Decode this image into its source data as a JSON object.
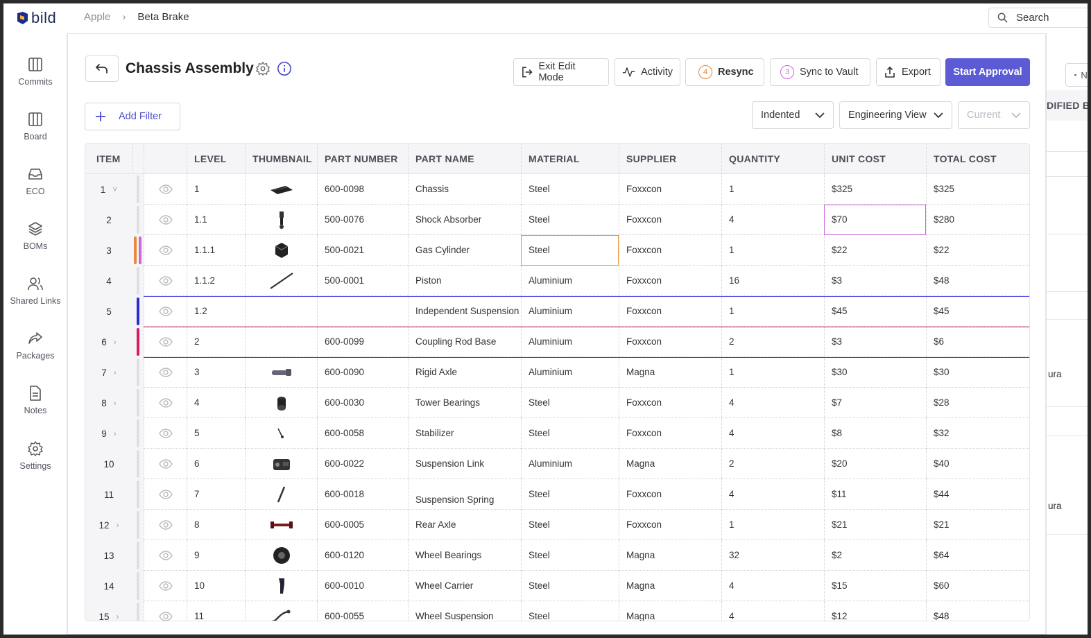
{
  "app": {
    "logo_text": "bild",
    "brand_color": "#5b5bd6",
    "breadcrumb": [
      "Apple",
      "Beta Brake"
    ],
    "search_label": "Search"
  },
  "sidebar": {
    "items": [
      {
        "label": "Commits",
        "icon": "columns-icon"
      },
      {
        "label": "Board",
        "icon": "board-icon"
      },
      {
        "label": "ECO",
        "icon": "inbox-icon"
      },
      {
        "label": "BOMs",
        "icon": "layers-icon"
      },
      {
        "label": "Shared Links",
        "icon": "users-icon"
      },
      {
        "label": "Packages",
        "icon": "share-icon"
      },
      {
        "label": "Notes",
        "icon": "note-icon"
      },
      {
        "label": "Settings",
        "icon": "gear-icon"
      }
    ]
  },
  "header": {
    "title": "Chassis Assembly",
    "buttons": {
      "exit_edit": "Exit Edit Mode",
      "activity": "Activity",
      "resync": "Resync",
      "resync_count": "4",
      "sync_vault": "Sync to Vault",
      "sync_vault_count": "3",
      "export": "Export",
      "start_approval": "Start Approval"
    }
  },
  "toolbar": {
    "add_filter": "Add Filter",
    "view_mode": "Indented",
    "view_type": "Engineering View",
    "version": "Current"
  },
  "table": {
    "columns": [
      "ITEM",
      "LEVEL",
      "THUMBNAIL",
      "PART NUMBER",
      "PART NAME",
      "MATERIAL",
      "SUPPLIER",
      "QUANTITY",
      "UNIT COST",
      "TOTAL COST"
    ],
    "rows": [
      {
        "item": "1",
        "level": "1",
        "part_number": "600-0098",
        "part_name": "Chassis",
        "material": "Steel",
        "supplier": "Foxxcon",
        "quantity": "1",
        "unit_cost": "$325",
        "total_cost": "$325"
      },
      {
        "item": "2",
        "level": "1.1",
        "part_number": "500-0076",
        "part_name": "Shock Absorber",
        "material": "Steel",
        "supplier": "Foxxcon",
        "quantity": "4",
        "unit_cost": "$70",
        "total_cost": "$280"
      },
      {
        "item": "3",
        "level": "1.1.1",
        "part_number": "500-0021",
        "part_name": "Gas Cylinder",
        "material": "Steel",
        "supplier": "Foxxcon",
        "quantity": "1",
        "unit_cost": "$22",
        "total_cost": "$22"
      },
      {
        "item": "4",
        "level": "1.1.2",
        "part_number": "500-0001",
        "part_name": "Piston",
        "material": "Aluminium",
        "supplier": "Foxxcon",
        "quantity": "16",
        "unit_cost": "$3",
        "total_cost": "$48"
      },
      {
        "item": "5",
        "level": "1.2",
        "part_number": "",
        "part_name": "Independent Suspension",
        "material": "Aluminium",
        "supplier": "Foxxcon",
        "quantity": "1",
        "unit_cost": "$45",
        "total_cost": "$45"
      },
      {
        "item": "6",
        "level": "2",
        "part_number": "600-0099",
        "part_name": "Coupling Rod Base",
        "material": "Aluminium",
        "supplier": "Foxxcon",
        "quantity": "2",
        "unit_cost": "$3",
        "total_cost": "$6"
      },
      {
        "item": "7",
        "level": "3",
        "part_number": "600-0090",
        "part_name": "Rigid Axle",
        "material": "Aluminium",
        "supplier": "Magna",
        "quantity": "1",
        "unit_cost": "$30",
        "total_cost": "$30"
      },
      {
        "item": "8",
        "level": "4",
        "part_number": "600-0030",
        "part_name": "Tower Bearings",
        "material": "Steel",
        "supplier": "Foxxcon",
        "quantity": "4",
        "unit_cost": "$7",
        "total_cost": "$28"
      },
      {
        "item": "9",
        "level": "5",
        "part_number": "600-0058",
        "part_name": "Stabilizer",
        "material": "Steel",
        "supplier": "Foxxcon",
        "quantity": "4",
        "unit_cost": "$8",
        "total_cost": "$32"
      },
      {
        "item": "10",
        "level": "6",
        "part_number": "600-0022",
        "part_name": "Suspension Link",
        "material": "Aluminium",
        "supplier": "Magna",
        "quantity": "2",
        "unit_cost": "$20",
        "total_cost": "$40"
      },
      {
        "item": "11",
        "level": "7",
        "part_number": "600-0018",
        "part_name": "Suspension Spring",
        "material": "Steel",
        "supplier": "Foxxcon",
        "quantity": "4",
        "unit_cost": "$11",
        "total_cost": "$44"
      },
      {
        "item": "12",
        "level": "8",
        "part_number": "600-0005",
        "part_name": "Rear Axle",
        "material": "Steel",
        "supplier": "Foxxcon",
        "quantity": "1",
        "unit_cost": "$21",
        "total_cost": "$21"
      },
      {
        "item": "13",
        "level": "9",
        "part_number": "600-0120",
        "part_name": "Wheel Bearings",
        "material": "Steel",
        "supplier": "Magna",
        "quantity": "32",
        "unit_cost": "$2",
        "total_cost": "$64"
      },
      {
        "item": "14",
        "level": "10",
        "part_number": "600-0010",
        "part_name": "Wheel Carrier",
        "material": "Steel",
        "supplier": "Magna",
        "quantity": "4",
        "unit_cost": "$15",
        "total_cost": "$60"
      },
      {
        "item": "15",
        "level": "11",
        "part_number": "600-0055",
        "part_name": "Wheel Suspension",
        "material": "Steel",
        "supplier": "Magna",
        "quantity": "4",
        "unit_cost": "$12",
        "total_cost": "$48"
      }
    ]
  },
  "right_panel": {
    "button_label": "Ne",
    "column_header": "DIFIED BY",
    "values": [
      "ura",
      "ura"
    ]
  }
}
